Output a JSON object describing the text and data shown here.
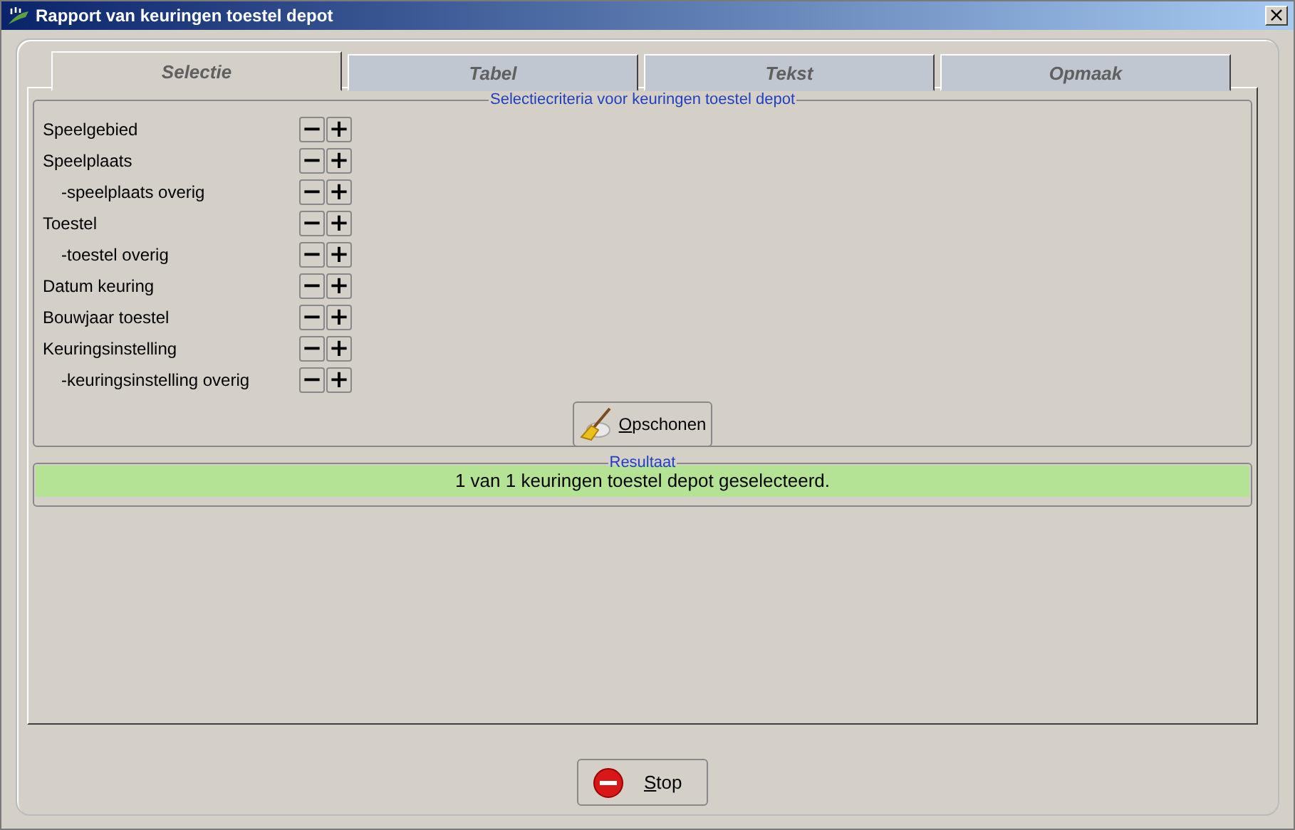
{
  "window": {
    "title": "Rapport van keuringen toestel depot",
    "close": "×"
  },
  "tabs": [
    {
      "label": "Selectie",
      "selected": true
    },
    {
      "label": "Tabel",
      "selected": false
    },
    {
      "label": "Tekst",
      "selected": false
    },
    {
      "label": "Opmaak",
      "selected": false
    }
  ],
  "criteria": {
    "legend": "Selectiecriteria voor keuringen toestel depot",
    "rows": [
      {
        "label": "Speelgebied",
        "children": []
      },
      {
        "label": "Speelplaats",
        "children": [
          {
            "label": "-speelplaats overig"
          }
        ]
      },
      {
        "label": "Toestel",
        "children": [
          {
            "label": "-toestel overig"
          }
        ]
      },
      {
        "label": "Datum keuring",
        "children": []
      },
      {
        "label": "Bouwjaar toestel",
        "children": []
      },
      {
        "label": "Keuringsinstelling",
        "children": [
          {
            "label": "-keuringsinstelling overig"
          }
        ]
      }
    ],
    "minus": "−",
    "plus": "+",
    "clear_button": "Opschonen"
  },
  "result": {
    "legend": "Resultaat",
    "message": "1 van 1 keuringen toestel depot geselecteerd."
  },
  "stop_button": "Stop"
}
